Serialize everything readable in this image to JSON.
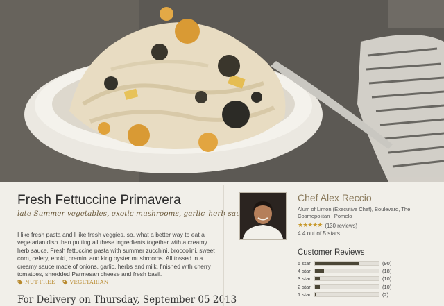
{
  "dish": {
    "title": "Fresh Fettuccine Primavera",
    "subtitle": "late Summer vegetables, exotic mushrooms, garlic–herb sauce",
    "description": "I like fresh pasta and I like fresh veggies, so, what a better way to eat a vegetarian dish than putting all these ingredients together with a creamy herb sauce. Fresh fettuccine pasta with summer zucchini, broccolini, sweet corn, celery, enoki, cremini and king oyster mushrooms. All tossed in a creamy sauce made of onions, garlic, herbs and milk, finished with cherry tomatoes, shredded Parmesan cheese and fresh basil.",
    "tags": [
      {
        "label": "NUT-FREE",
        "icon": "tag-icon"
      },
      {
        "label": "VEGETARIAN",
        "icon": "tag-icon"
      }
    ],
    "delivery": "For Delivery on Thursday, September 05 2013"
  },
  "chef": {
    "name": "Chef Alex Reccio",
    "bio": "Alum of Limon (Executive Chef), Boulevard, The Cosmopolitan , Pomelo",
    "stars": 4.4,
    "stars_glyph": "★★★★★",
    "reviews_count": "(130 reviews)",
    "rating_text": "4.4 out of 5 stars"
  },
  "reviews": {
    "title": "Customer Reviews",
    "rows": [
      {
        "label": "5 star",
        "count": "(90)",
        "fraction": 0.69
      },
      {
        "label": "4 star",
        "count": "(18)",
        "fraction": 0.14
      },
      {
        "label": "3 star",
        "count": "(10)",
        "fraction": 0.08
      },
      {
        "label": "2 star",
        "count": "(10)",
        "fraction": 0.08
      },
      {
        "label": "1 star",
        "count": "(2)",
        "fraction": 0.015
      }
    ]
  },
  "colors": {
    "accent": "#b8892d",
    "star": "#c89a2f",
    "bar": "#4b4636"
  }
}
